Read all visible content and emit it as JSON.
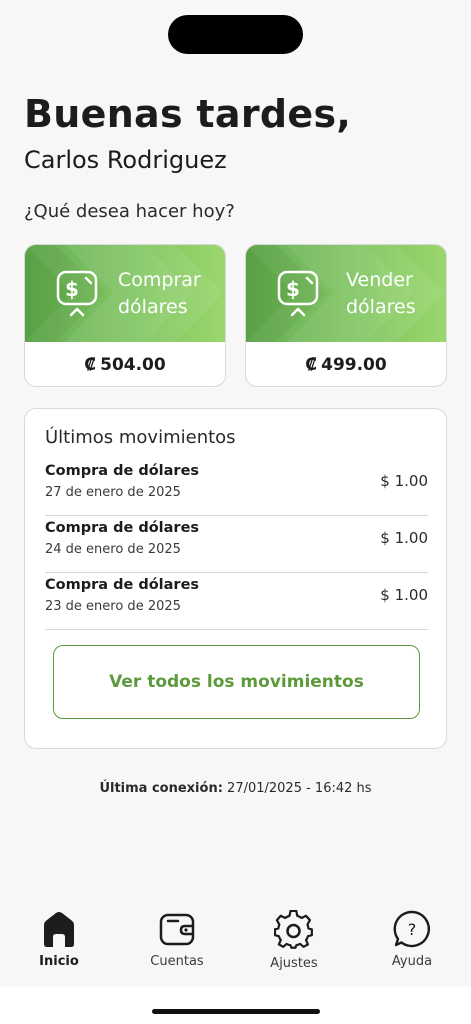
{
  "header": {
    "greeting": "Buenas tardes,",
    "user_name": "Carlos Rodriguez",
    "question": "¿Qué desea hacer hoy?"
  },
  "actions": {
    "buy": {
      "label_line1": "Comprar",
      "label_line2": "dólares",
      "currency_symbol": "₡",
      "price": "504.00",
      "icon": "dollar-exchange-icon"
    },
    "sell": {
      "label_line1": "Vender",
      "label_line2": "dólares",
      "currency_symbol": "₡",
      "price": "499.00",
      "icon": "dollar-exchange-icon"
    }
  },
  "movements": {
    "title": "Últimos movimientos",
    "items": [
      {
        "name": "Compra de dólares",
        "date": "27 de enero de 2025",
        "amount": "$ 1.00"
      },
      {
        "name": "Compra de dólares",
        "date": "24 de enero de 2025",
        "amount": "$ 1.00"
      },
      {
        "name": "Compra de dólares",
        "date": "23 de enero de 2025",
        "amount": "$ 1.00"
      }
    ],
    "see_all_label": "Ver todos los movimientos"
  },
  "last_connection": {
    "label": "Última conexión:",
    "value": "27/01/2025 - 16:42 hs"
  },
  "tabbar": {
    "items": [
      {
        "label": "Inicio",
        "icon": "home-icon",
        "active": true
      },
      {
        "label": "Cuentas",
        "icon": "wallet-icon",
        "active": false
      },
      {
        "label": "Ajustes",
        "icon": "gear-icon",
        "active": false
      },
      {
        "label": "Ayuda",
        "icon": "help-bubble-icon",
        "active": false
      }
    ]
  },
  "colors": {
    "accent": "#5c9a3c",
    "card_gradient_start": "#5da84a",
    "card_gradient_end": "#9bd76e",
    "background": "#f7f7f7"
  }
}
